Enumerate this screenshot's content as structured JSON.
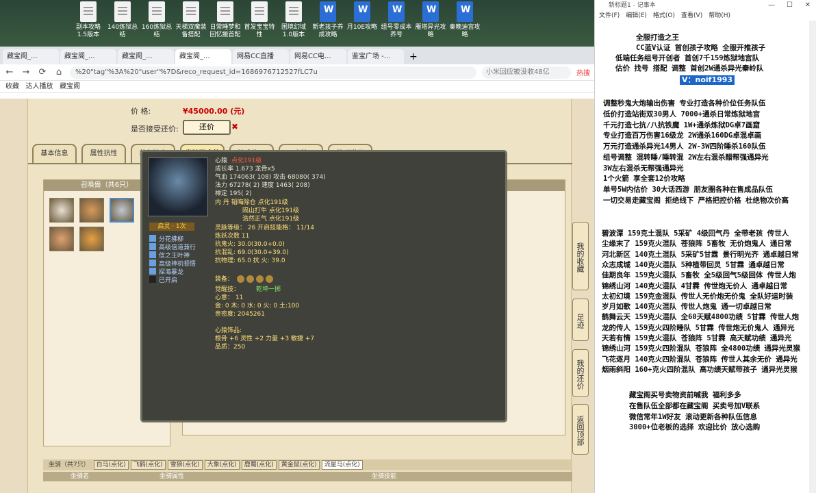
{
  "desktop": {
    "icons": [
      {
        "label": "副本攻略1.5版本",
        "type": "doc"
      },
      {
        "label": "140炼狱总结",
        "type": "doc"
      },
      {
        "label": "160炼狱总结",
        "type": "doc"
      },
      {
        "label": "天梯双魔装备搭配",
        "type": "doc"
      },
      {
        "label": "日常睡梦和回忆搬首配",
        "type": "doc"
      },
      {
        "label": "首发宝宝特性",
        "type": "doc"
      },
      {
        "label": "困境幻域1.0版本",
        "type": "doc"
      },
      {
        "label": "新老孩子养成攻略",
        "type": "word"
      },
      {
        "label": "月10E攻略",
        "type": "word"
      },
      {
        "label": "组号零成本养号",
        "type": "word"
      },
      {
        "label": "雁塔异光攻略",
        "type": "word"
      },
      {
        "label": "秦晚迪宫攻略",
        "type": "word"
      }
    ]
  },
  "browser": {
    "tabs": [
      "藏宝阁_...",
      "藏宝阁_...",
      "藏宝阁_...",
      "藏宝阁_...",
      "网易CC直播",
      "网易CC电...",
      "鉴宝广场 -..."
    ],
    "url": "%20\"tag\"%3A%20\"user\"%7D&reco_request_id=1686976712527fLC7u",
    "search_placeholder": "小米回应被没收48亿",
    "hot_label": "热搜",
    "bookmarks": [
      "收藏",
      "达人播放",
      "藏宝阁"
    ]
  },
  "listing": {
    "price_label": "价        格:",
    "price_value": "¥45000.00 (元)",
    "bargain_label": "是否接受还价:",
    "bargain_button": "还价",
    "tabs": [
      "基本信息",
      "属性抗性",
      "装备法宝",
      "坐骑召唤兽",
      "法术修正",
      "小孩",
      "外观道具"
    ],
    "pet_panel_title": "召唤兽（共6只）",
    "right_panel_title": "心猿",
    "side_buttons": [
      "我的收藏",
      "足迹",
      "我的还价",
      "返回顶部"
    ],
    "mount_bar": "坐骑（共7只）",
    "mount_tabs": [
      "白马(点化)",
      "飞鹤(点化)",
      "雪狼(点化)",
      "大象(点化)",
      "鹿蜀(点化)",
      "黄金鼠(点化)",
      "流星马(点化)"
    ],
    "mount_head": [
      "坐骑名",
      "坐骑属性",
      "坐骑技能"
    ]
  },
  "tooltip": {
    "name": "心猿",
    "name_tag": "点化191级",
    "growth": "成长率 1.673 龙骨x5",
    "hp_atk": "气血 174063( 108) 攻击 68080( 374)",
    "mp_spd": "法力 67278( 2) 速度 1463( 208)",
    "zen": "禅定 195( 2)",
    "dan": [
      "内  丹 韬晦除仓 点化191级",
      "隔山打牛 点化191级",
      "浩然正气 点化191级"
    ],
    "spirit": "灵脉等级：  26 开启技能格：  11/14",
    "refine": "炼妖次数 11",
    "resist": [
      "抗鬼火: 30.0(30.0+0.0)",
      "抗混乱: 69.0(30.0+39.0)",
      "抗物理: 65.0 抗    火: 39.0"
    ],
    "skill_header": "启灵 · 1次",
    "skills": [
      "分花拂柳",
      "高级倍道兼行",
      "信之王叶神",
      "高级神机顿悟",
      "探海暴龙",
      "已开启"
    ],
    "equip_label": "装备：",
    "awaken": "觉醒技：",
    "awaken_skill": "乾坤一掷",
    "heart": "心意：  11",
    "elements": "金: 0 木: 0 水: 0 火: 0 土:100",
    "intimacy": "亲密度: 2045261",
    "ornament_title": "心猿饰品:",
    "ornament": "根骨 +6 灵性 +2 力量 +3 敏捷 +7",
    "quality": "品质：250"
  },
  "notepad": {
    "title": "新标题1 - 记事本",
    "menu": [
      "文件(F)",
      "编辑(E)",
      "格式(O)",
      "查看(V)",
      "帮助(H)"
    ],
    "header": [
      "全服打造之王",
      "CC蓝V认证 首创孩子攻略 全服开推孩子",
      "低端任务组号开创者          首创7千159炼狱地宫队",
      "估价 找号 搭配 调整          首创2W通杀异光秦岭队"
    ],
    "wechat": "V：noif1993",
    "block1": [
      "调整秒鬼大炮输出伤害          专业打造各种价位任务队伍",
      "低价打造站街双30男人            7000+通杀日常炼狱地宫",
      "千元打造七抗/八抗铁魔            1W+通杀炼狱DG卓7画窟",
      "专业打造百万伤害16级龙          2W通杀160DG卓混卓画",
      "万元打造通杀异光14男人          2W-3W四阶睡杀160队伍",
      "组号调整 混转睡/睡转混            2W左右混杀醋帮强通异光",
      "                                    3W左右混杀无帮强通异光"
    ],
    "block2": [
      "1个火箭 享全套12价攻略",
      "单号5W内估价 30大话西游          朋友圈各种在售成品队伍",
      "一切交易走藏宝阁 拒绝线下      严格把控价格 杜绝物次价高"
    ],
    "block3": [
      "碧波潭    159克土混队  5采矿  4级回气丹  全带老孩  传世人",
      "尘缘末了 159克火混队  苍狼阵  5畜牧  无价炮鬼人  通日常",
      "河北新区 140克土混队  5采矿5甘霖  景行明光齐  通卓越日常",
      "众志成城 140克火混队  5种植带回灵  5甘霖  通卓越日常",
      "佳期良年 159克火混队  5畜牧  全5级回气5级回体  传世人炮",
      "锦绣山河 140克火混队  4甘霖  传世炮无价人  通卓越日常",
      "太初幻境 159克金混队  传世人无价炮无价鬼  全队好运时装",
      "岁月如歌 140克火混队  传世人炮鬼  通一切卓越日常",
      "鹤舞云天 159克火混队  全60天赋4800功绩  5甘霖  传世人炮",
      "龙的传人 159克火四阶睡队  5甘霖  传世炮无价鬼人  通异光",
      "天若有情 159克火混队  苍狼阵  5甘霖  高天赋功绩  通异光",
      "锦绣山河 159克火四阶混队  苍狼阵  全4800功绩  通异光灵猴",
      "飞花逐月 140克火四阶混队  苍狼阵  传世人其余无价  通异光",
      "烟雨斜阳 160+克火四阶混队  高功绩天赋带孩子  通异光灵猴"
    ],
    "block4": [
      "藏宝阁买号卖物资前喊我  福利多多",
      "在售队伍全部都在藏宝阁  买卖号加V联系",
      "微信常年1W好友  滚动更新各种队伍信息",
      "3000+位老板的选择  欢迎比价  放心选购"
    ]
  }
}
